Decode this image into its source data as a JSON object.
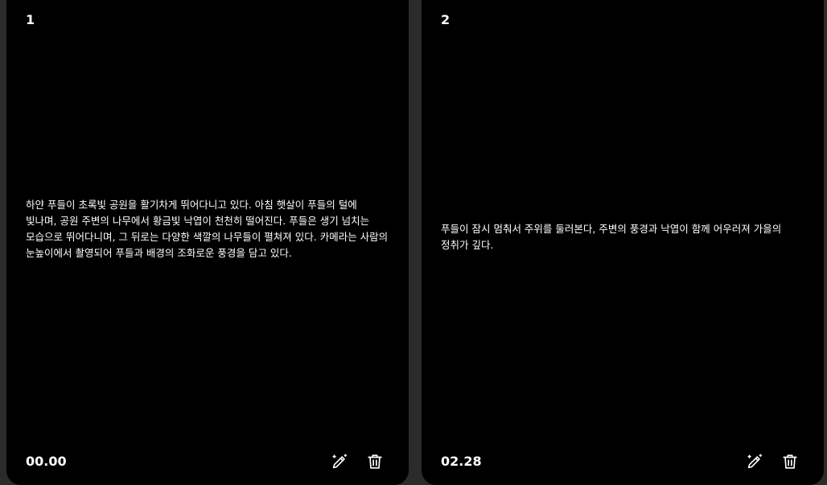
{
  "cards": [
    {
      "number": "1",
      "text": "하얀 푸들이 초록빛 공원을 활기차게 뛰어다니고 있다. 아침 햇살이 푸들의 털에 빛나며, 공원 주변의 나무에서 황금빛 낙엽이 천천히 떨어진다. 푸들은 생기 넘치는 모습으로 뛰어다니며, 그 뒤로는 다양한 색깔의 나무들이 펼쳐져 있다. 카메라는 사람의 눈높이에서 촬영되어 푸들과 배경의 조화로운 풍경을 담고 있다.",
      "time": "00.00",
      "edit_icon": "magic-pencil-icon",
      "delete_icon": "trash-icon"
    },
    {
      "number": "2",
      "text": "푸들이 잠시 멈춰서 주위를 둘러본다, 주변의 풍경과 낙엽이 함께 어우러져 가을의 정취가 깊다.",
      "time": "02.28",
      "edit_icon": "magic-pencil-icon",
      "delete_icon": "trash-icon"
    }
  ],
  "colors": {
    "background": "#2b2b2b",
    "card": "#000000",
    "text": "#ffffff"
  }
}
